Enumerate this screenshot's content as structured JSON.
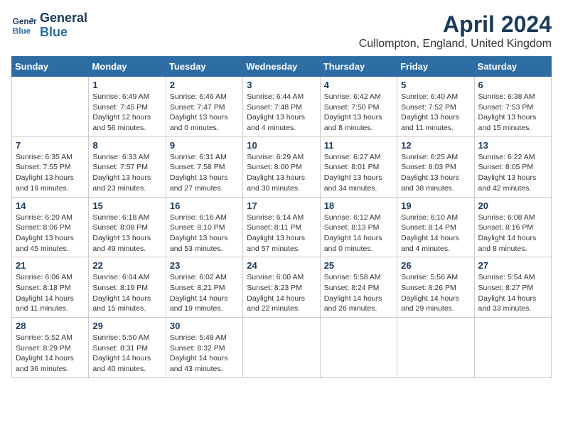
{
  "header": {
    "logo_line1": "General",
    "logo_line2": "Blue",
    "month_title": "April 2024",
    "location": "Cullompton, England, United Kingdom"
  },
  "weekdays": [
    "Sunday",
    "Monday",
    "Tuesday",
    "Wednesday",
    "Thursday",
    "Friday",
    "Saturday"
  ],
  "weeks": [
    [
      {
        "day": "",
        "info": ""
      },
      {
        "day": "1",
        "info": "Sunrise: 6:49 AM\nSunset: 7:45 PM\nDaylight: 12 hours\nand 56 minutes."
      },
      {
        "day": "2",
        "info": "Sunrise: 6:46 AM\nSunset: 7:47 PM\nDaylight: 13 hours\nand 0 minutes."
      },
      {
        "day": "3",
        "info": "Sunrise: 6:44 AM\nSunset: 7:48 PM\nDaylight: 13 hours\nand 4 minutes."
      },
      {
        "day": "4",
        "info": "Sunrise: 6:42 AM\nSunset: 7:50 PM\nDaylight: 13 hours\nand 8 minutes."
      },
      {
        "day": "5",
        "info": "Sunrise: 6:40 AM\nSunset: 7:52 PM\nDaylight: 13 hours\nand 11 minutes."
      },
      {
        "day": "6",
        "info": "Sunrise: 6:38 AM\nSunset: 7:53 PM\nDaylight: 13 hours\nand 15 minutes."
      }
    ],
    [
      {
        "day": "7",
        "info": "Sunrise: 6:35 AM\nSunset: 7:55 PM\nDaylight: 13 hours\nand 19 minutes."
      },
      {
        "day": "8",
        "info": "Sunrise: 6:33 AM\nSunset: 7:57 PM\nDaylight: 13 hours\nand 23 minutes."
      },
      {
        "day": "9",
        "info": "Sunrise: 6:31 AM\nSunset: 7:58 PM\nDaylight: 13 hours\nand 27 minutes."
      },
      {
        "day": "10",
        "info": "Sunrise: 6:29 AM\nSunset: 8:00 PM\nDaylight: 13 hours\nand 30 minutes."
      },
      {
        "day": "11",
        "info": "Sunrise: 6:27 AM\nSunset: 8:01 PM\nDaylight: 13 hours\nand 34 minutes."
      },
      {
        "day": "12",
        "info": "Sunrise: 6:25 AM\nSunset: 8:03 PM\nDaylight: 13 hours\nand 38 minutes."
      },
      {
        "day": "13",
        "info": "Sunrise: 6:22 AM\nSunset: 8:05 PM\nDaylight: 13 hours\nand 42 minutes."
      }
    ],
    [
      {
        "day": "14",
        "info": "Sunrise: 6:20 AM\nSunset: 8:06 PM\nDaylight: 13 hours\nand 45 minutes."
      },
      {
        "day": "15",
        "info": "Sunrise: 6:18 AM\nSunset: 8:08 PM\nDaylight: 13 hours\nand 49 minutes."
      },
      {
        "day": "16",
        "info": "Sunrise: 6:16 AM\nSunset: 8:10 PM\nDaylight: 13 hours\nand 53 minutes."
      },
      {
        "day": "17",
        "info": "Sunrise: 6:14 AM\nSunset: 8:11 PM\nDaylight: 13 hours\nand 57 minutes."
      },
      {
        "day": "18",
        "info": "Sunrise: 6:12 AM\nSunset: 8:13 PM\nDaylight: 14 hours\nand 0 minutes."
      },
      {
        "day": "19",
        "info": "Sunrise: 6:10 AM\nSunset: 8:14 PM\nDaylight: 14 hours\nand 4 minutes."
      },
      {
        "day": "20",
        "info": "Sunrise: 6:08 AM\nSunset: 8:16 PM\nDaylight: 14 hours\nand 8 minutes."
      }
    ],
    [
      {
        "day": "21",
        "info": "Sunrise: 6:06 AM\nSunset: 8:18 PM\nDaylight: 14 hours\nand 11 minutes."
      },
      {
        "day": "22",
        "info": "Sunrise: 6:04 AM\nSunset: 8:19 PM\nDaylight: 14 hours\nand 15 minutes."
      },
      {
        "day": "23",
        "info": "Sunrise: 6:02 AM\nSunset: 8:21 PM\nDaylight: 14 hours\nand 19 minutes."
      },
      {
        "day": "24",
        "info": "Sunrise: 6:00 AM\nSunset: 8:23 PM\nDaylight: 14 hours\nand 22 minutes."
      },
      {
        "day": "25",
        "info": "Sunrise: 5:58 AM\nSunset: 8:24 PM\nDaylight: 14 hours\nand 26 minutes."
      },
      {
        "day": "26",
        "info": "Sunrise: 5:56 AM\nSunset: 8:26 PM\nDaylight: 14 hours\nand 29 minutes."
      },
      {
        "day": "27",
        "info": "Sunrise: 5:54 AM\nSunset: 8:27 PM\nDaylight: 14 hours\nand 33 minutes."
      }
    ],
    [
      {
        "day": "28",
        "info": "Sunrise: 5:52 AM\nSunset: 8:29 PM\nDaylight: 14 hours\nand 36 minutes."
      },
      {
        "day": "29",
        "info": "Sunrise: 5:50 AM\nSunset: 8:31 PM\nDaylight: 14 hours\nand 40 minutes."
      },
      {
        "day": "30",
        "info": "Sunrise: 5:48 AM\nSunset: 8:32 PM\nDaylight: 14 hours\nand 43 minutes."
      },
      {
        "day": "",
        "info": ""
      },
      {
        "day": "",
        "info": ""
      },
      {
        "day": "",
        "info": ""
      },
      {
        "day": "",
        "info": ""
      }
    ]
  ]
}
